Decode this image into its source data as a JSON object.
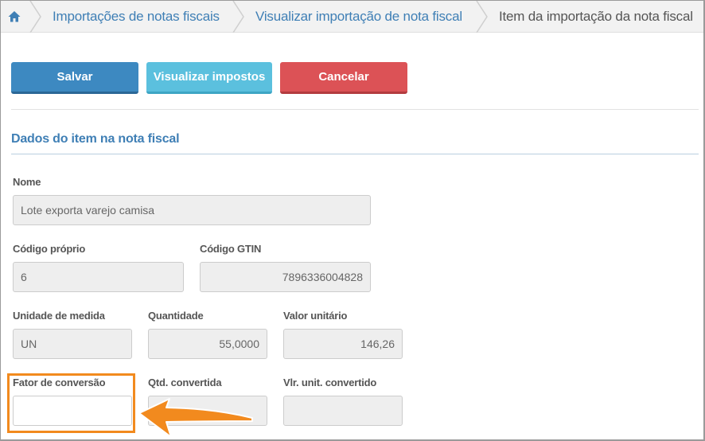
{
  "breadcrumb": {
    "home_icon": "home-icon",
    "items": [
      {
        "label": "Importações de notas fiscais"
      },
      {
        "label": "Visualizar importação de nota fiscal"
      },
      {
        "label": "Item da importação da nota fiscal"
      }
    ]
  },
  "toolbar": {
    "save_label": "Salvar",
    "taxes_label": "Visualizar impostos",
    "cancel_label": "Cancelar"
  },
  "section": {
    "title": "Dados do item na nota fiscal"
  },
  "fields": {
    "nome": {
      "label": "Nome",
      "value": "Lote exporta varejo camisa"
    },
    "codigo_proprio": {
      "label": "Código próprio",
      "value": "6"
    },
    "codigo_gtin": {
      "label": "Código GTIN",
      "value": "7896336004828"
    },
    "unidade": {
      "label": "Unidade de medida",
      "value": "UN"
    },
    "quantidade": {
      "label": "Quantidade",
      "value": "55,0000"
    },
    "valor_unitario": {
      "label": "Valor unitário",
      "value": "146,26"
    },
    "fator_conversao": {
      "label": "Fator de conversão",
      "value": ""
    },
    "qtd_convertida": {
      "label": "Qtd. convertida",
      "value": ""
    },
    "vlr_unit_convertido": {
      "label": "Vlr. unit. convertido",
      "value": ""
    }
  },
  "colors": {
    "primary": "#3d89c1",
    "info": "#5bc0de",
    "danger": "#dc5256",
    "link": "#3f7fb5",
    "highlight": "#f28a1e"
  }
}
